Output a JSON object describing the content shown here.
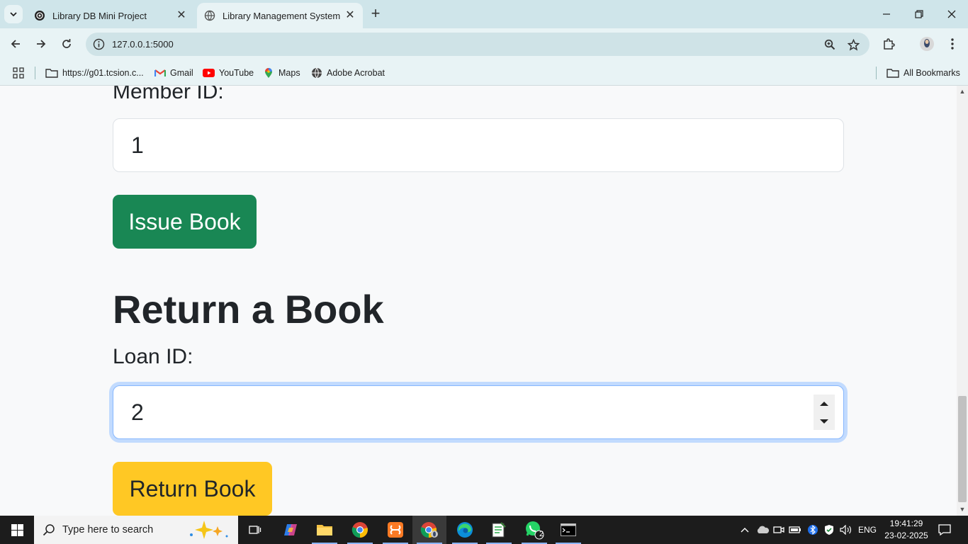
{
  "browser": {
    "tabs": [
      {
        "title": "Library DB Mini Project"
      },
      {
        "title": "Library Management System"
      }
    ],
    "url": "127.0.0.1:5000",
    "bookmarks": [
      {
        "label": "https://g01.tcsion.c..."
      },
      {
        "label": "Gmail"
      },
      {
        "label": "YouTube"
      },
      {
        "label": "Maps"
      },
      {
        "label": "Adobe Acrobat"
      }
    ],
    "all_bookmarks": "All Bookmarks"
  },
  "page": {
    "member_label": "Member ID:",
    "member_value": "1",
    "issue_button": "Issue Book",
    "return_heading": "Return a Book",
    "loan_label": "Loan ID:",
    "loan_value": "2",
    "return_button": "Return Book"
  },
  "taskbar": {
    "search_placeholder": "Type here to search",
    "language": "ENG",
    "time": "19:41:29",
    "date": "23-02-2025",
    "whatsapp_badge": "2"
  },
  "colors": {
    "issue_button": "#198754",
    "return_button": "#ffc824",
    "focus_ring": "#86b7fe"
  }
}
